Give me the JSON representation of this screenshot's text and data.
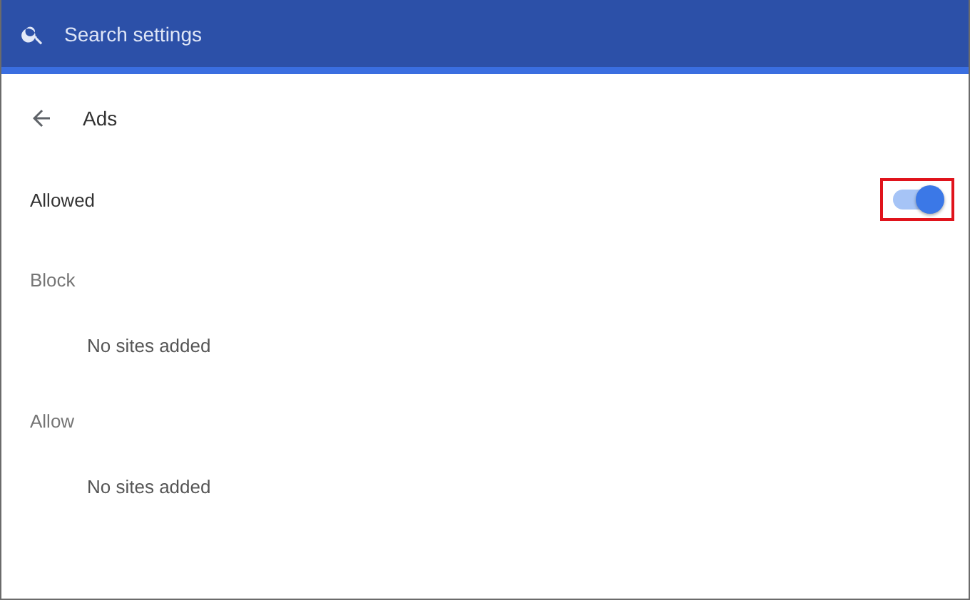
{
  "search": {
    "placeholder": "Search settings"
  },
  "page": {
    "title": "Ads"
  },
  "setting": {
    "label": "Allowed",
    "on": true,
    "highlighted": true
  },
  "sections": [
    {
      "title": "Block",
      "empty_text": "No sites added"
    },
    {
      "title": "Allow",
      "empty_text": "No sites added"
    }
  ]
}
